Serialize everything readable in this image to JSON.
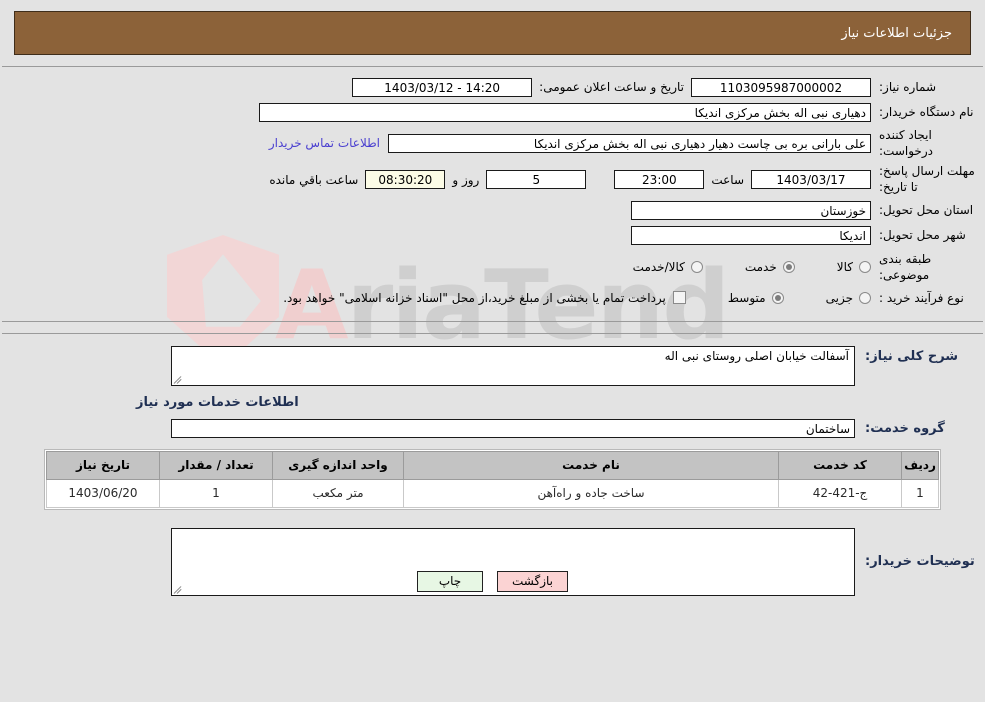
{
  "header": {
    "title": "جزئیات اطلاعات نیاز"
  },
  "form": {
    "need_number_label": "شماره نیاز:",
    "need_number_value": "1103095987000002",
    "public_announce_label": "تاریخ و ساعت اعلان عمومی:",
    "public_announce_value": "14:20 - 1403/03/12",
    "buyer_org_label": "نام دستگاه خریدار:",
    "buyer_org_value": "دهیاری نبی اله بخش مرکزی اندیکا",
    "creator_label": "ایجاد کننده درخواست:",
    "creator_value": "علی بارانی بره بی چاست دهیار دهیاری نبی اله بخش مرکزی اندیکا",
    "contact_link": "اطلاعات تماس خریدار",
    "deadline_label": "مهلت ارسال پاسخ: تا تاریخ:",
    "deadline_date": "1403/03/17",
    "deadline_hour_label": "ساعت",
    "deadline_hour_value": "23:00",
    "remaining_days_value": "5",
    "remaining_days_label": "روز و",
    "remaining_time_value": "08:30:20",
    "remaining_time_label": "ساعت باقي مانده",
    "province_label": "استان محل تحویل:",
    "province_value": "خوزستان",
    "city_label": "شهر محل تحویل:",
    "city_value": "اندیکا",
    "category_label": "طبقه بندی موضوعی:",
    "category_options": [
      "کالا",
      "خدمت",
      "کالا/خدمت"
    ],
    "category_selected": "خدمت",
    "process_label": "نوع فرآیند خرید :",
    "process_options": [
      "جزیی",
      "متوسط"
    ],
    "process_selected": "متوسط",
    "treasury_note": "پرداخت تمام یا بخشی از مبلغ خرید،از محل \"اسناد خزانه اسلامی\" خواهد بود.",
    "treasury_checked": false
  },
  "description": {
    "general_label": "شرح کلی نیاز:",
    "general_value": "آسفالت خیابان اصلی روستای نبی اله",
    "services_section_title": "اطلاعات خدمات مورد نیاز",
    "service_group_label": "گروه خدمت:",
    "service_group_value": "ساختمان"
  },
  "table": {
    "columns": [
      "ردیف",
      "کد خدمت",
      "نام خدمت",
      "واحد اندازه گیری",
      "تعداد / مقدار",
      "تاریخ نیاز"
    ],
    "rows": [
      {
        "radif": "1",
        "code": "ج-421-42",
        "name": "ساخت جاده و راه‌آهن",
        "unit": "متر مکعب",
        "qty": "1",
        "date": "1403/06/20"
      }
    ]
  },
  "notes": {
    "label": "توضیحات خریدار:",
    "value": ""
  },
  "footer": {
    "back_label": "بازگشت",
    "print_label": "چاپ"
  },
  "watermark": {
    "text": "AriaTender"
  },
  "colors": {
    "header_bg": "#8c6239",
    "page_bg": "#e3e3e3",
    "bold_label": "#1f2f52",
    "link": "#4a3fd0",
    "back_btn": "#fbd3d3",
    "print_btn": "#e7f7e4",
    "countdown_bg": "#fbfbe6",
    "table_header_bg": "#c3c3c3"
  }
}
